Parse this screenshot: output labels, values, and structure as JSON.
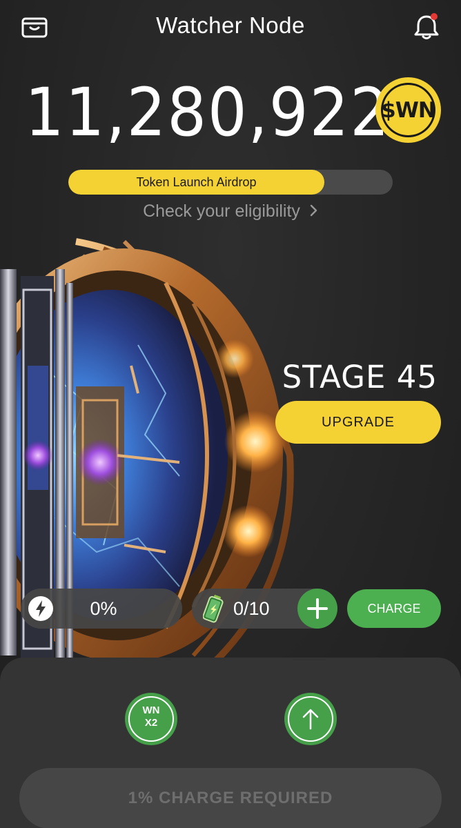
{
  "header": {
    "title": "Watcher Node",
    "wallet_icon": "wallet-icon",
    "bell_icon": "bell-icon",
    "notification_dot_color": "#e53935"
  },
  "balance": {
    "amount": "11,280,922",
    "token_symbol": "$WN",
    "token_color": "#f5d233"
  },
  "airdrop": {
    "label": "Token Launch Airdrop",
    "progress": 0.79,
    "eligibility_link": "Check your eligibility",
    "chevron_icon": "chevron-right-icon"
  },
  "stage": {
    "label": "STAGE 45",
    "upgrade_label": "UPGRADE"
  },
  "stats": {
    "energy_icon": "lightning-bolt-icon",
    "energy_value": "0%",
    "battery_icon": "battery-icon",
    "battery_value": "0/10",
    "add_icon": "plus-icon",
    "charge_label": "CHARGE"
  },
  "bottom": {
    "multiplier_label": "WN\nX2",
    "boost_icon": "arrow-up-icon",
    "action_label": "1% CHARGE REQUIRED"
  },
  "colors": {
    "accent_yellow": "#f5d233",
    "accent_green": "#4caf50",
    "background": "#262626",
    "panel": "#343434"
  }
}
